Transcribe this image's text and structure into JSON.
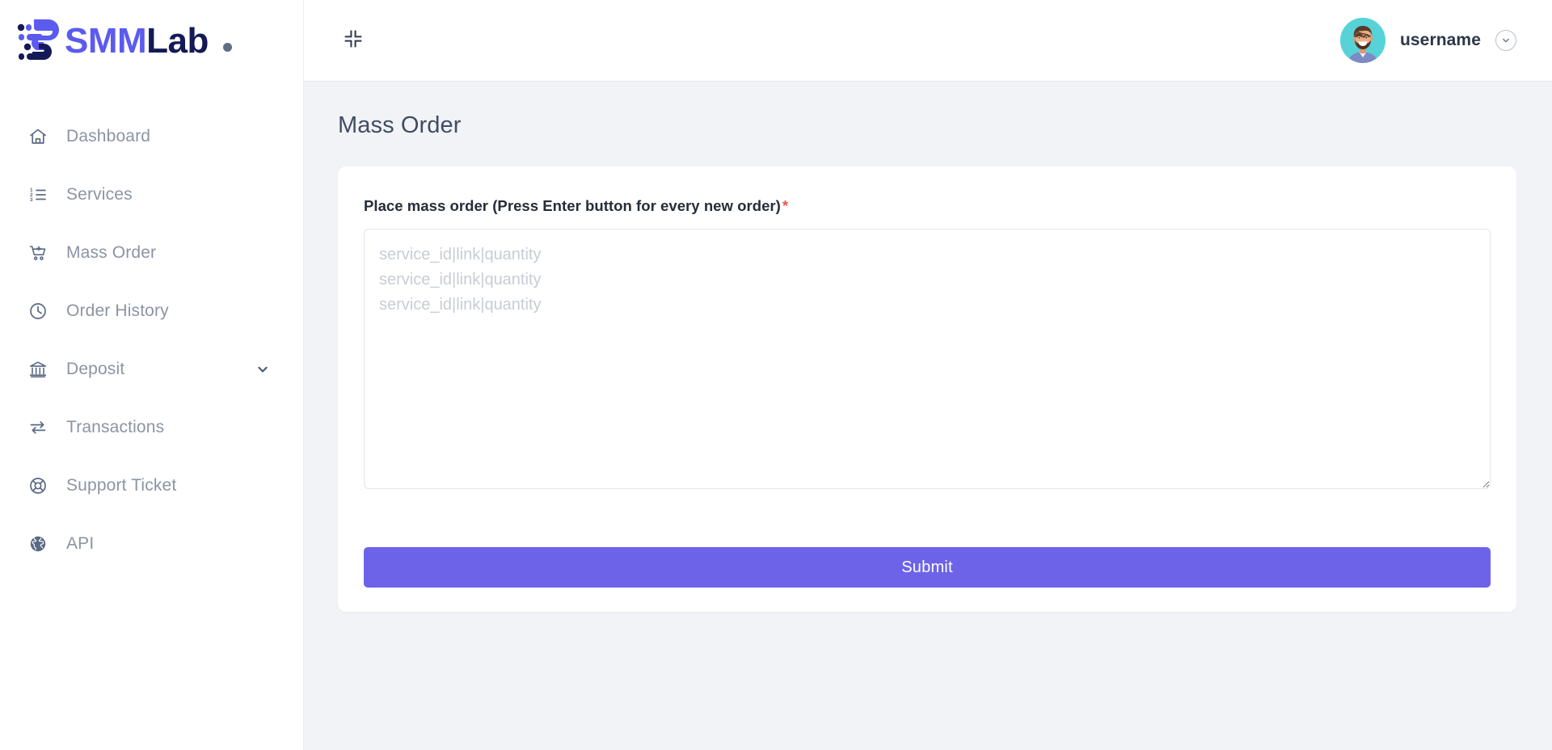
{
  "brand": {
    "name_part_a": "SMM",
    "name_part_b": "Lab",
    "mark_icon": "smmlab-speed-s-icon",
    "dot_icon": "brand-dot-icon",
    "colors": {
      "primary": "#5b5bf0",
      "dark": "#141a56",
      "dot": "#5e6d85"
    }
  },
  "sidebar": {
    "items": [
      {
        "label": "Dashboard",
        "icon": "home-icon",
        "key": "dashboard",
        "has_chevron": false
      },
      {
        "label": "Services",
        "icon": "ordered-list-icon",
        "key": "services",
        "has_chevron": false
      },
      {
        "label": "Mass Order",
        "icon": "cart-plus-icon",
        "key": "mass-order",
        "has_chevron": false
      },
      {
        "label": "Order History",
        "icon": "clock-icon",
        "key": "order-history",
        "has_chevron": false
      },
      {
        "label": "Deposit",
        "icon": "bank-icon",
        "key": "deposit",
        "has_chevron": true
      },
      {
        "label": "Transactions",
        "icon": "exchange-arrows-icon",
        "key": "transactions",
        "has_chevron": false
      },
      {
        "label": "Support Ticket",
        "icon": "life-ring-icon",
        "key": "support-ticket",
        "has_chevron": false
      },
      {
        "label": "API",
        "icon": "globe-icon",
        "key": "api",
        "has_chevron": false
      }
    ]
  },
  "topbar": {
    "collapse_icon": "compress-icon",
    "user": {
      "name": "username",
      "avatar_icon": "user-avatar-bearded-man",
      "chevron_icon": "chevron-down-circle-icon"
    }
  },
  "page": {
    "title": "Mass Order"
  },
  "form": {
    "label": "Place mass order (Press Enter button for every new order)",
    "required_mark": "*",
    "textarea": {
      "value": "",
      "placeholder": "service_id|link|quantity\nservice_id|link|quantity\nservice_id|link|quantity"
    },
    "submit_label": "Submit",
    "submit_color": "#6c63e8"
  }
}
